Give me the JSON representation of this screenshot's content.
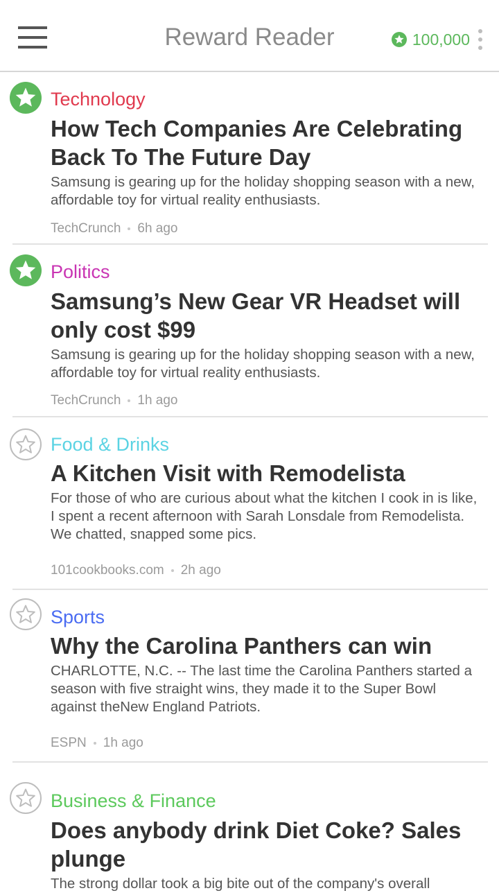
{
  "header": {
    "title": "Reward Reader",
    "points": "100,000",
    "points_color": "#5cb85c"
  },
  "articles": [
    {
      "starred": true,
      "category": "Technology",
      "category_color": "#e0394d",
      "title": "How Tech Companies Are Celebrating Back To The Future Day",
      "summary": "Samsung is gearing up for the holiday shopping season with a new, affordable toy for virtual reality enthusiasts.",
      "source": "TechCrunch",
      "time": "6h ago"
    },
    {
      "starred": true,
      "category": "Politics",
      "category_color": "#c935b3",
      "title": "Samsung’s New Gear VR Headset will only cost $99",
      "summary": "Samsung is gearing up for the holiday shopping season with a new, affordable toy for virtual reality enthusiasts.",
      "source": "TechCrunch",
      "time": "1h ago"
    },
    {
      "starred": false,
      "category": "Food & Drinks",
      "category_color": "#5bd3e3",
      "title": "A Kitchen Visit with Remodelista",
      "summary": "For those of who are curious about what the kitchen I cook in is like, I spent a recent afternoon with Sarah Lonsdale from Remodelista. We chatted, snapped some pics.",
      "source": "101cookbooks.com",
      "time": "2h ago"
    },
    {
      "starred": false,
      "category": "Sports",
      "category_color": "#4a6cf2",
      "title": "Why the Carolina Panthers can win",
      "summary": "CHARLOTTE, N.C. -- The last time the Carolina Panthers started a season with five straight wins, they made it to the Super Bowl against theNew England Patriots.",
      "source": "ESPN",
      "time": "1h ago"
    },
    {
      "starred": false,
      "category": "Business & Finance",
      "category_color": "#5cc95c",
      "title": "Does anybody drink Diet Coke? Sales plunge",
      "summary": "The strong dollar took a big bite out of the company's overall",
      "source": "",
      "time": ""
    }
  ]
}
